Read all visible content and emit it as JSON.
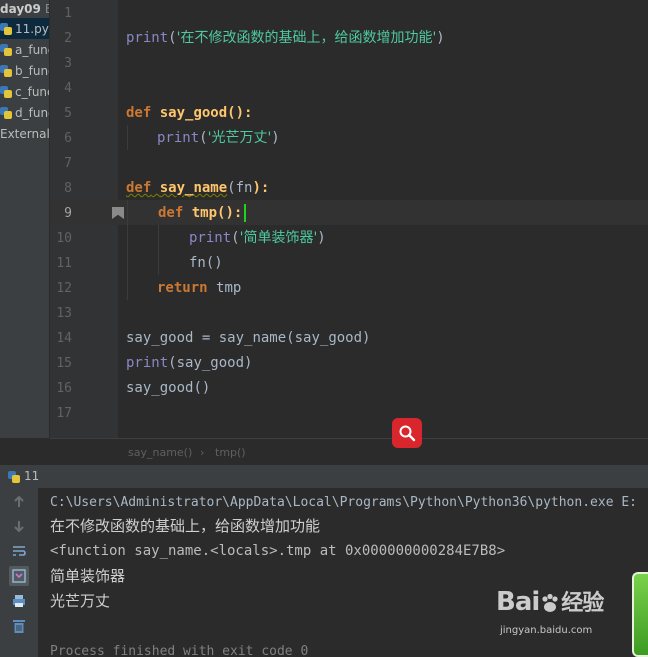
{
  "project": {
    "title": "day09",
    "path": "E:",
    "items": [
      {
        "label": "11.py",
        "icon": "python-file-icon"
      },
      {
        "label": "a_func",
        "icon": "python-file-icon"
      },
      {
        "label": "b_func",
        "icon": "python-file-icon"
      },
      {
        "label": "c_func",
        "icon": "python-file-icon"
      },
      {
        "label": "d_func",
        "icon": "python-file-icon"
      },
      {
        "label": "External L",
        "icon": "library-icon"
      }
    ]
  },
  "editor": {
    "line_numbers": [
      "1",
      "2",
      "3",
      "4",
      "5",
      "6",
      "7",
      "8",
      "9",
      "10",
      "11",
      "12",
      "13",
      "14",
      "15",
      "16",
      "17"
    ],
    "strings": {
      "s1": "'在不修改函数的基础上，给函数增加功能'",
      "s2": "'光芒万丈'",
      "s3": "'简单装饰器'"
    },
    "tokens": {
      "print": "print",
      "def": "def",
      "return": "return",
      "say_good": "say_good",
      "say_name": "say_name",
      "fn": "fn",
      "tmp": "tmp",
      "eq": " = "
    },
    "current_line": 9
  },
  "breadcrumb": {
    "items": [
      "say_name()",
      "tmp()"
    ],
    "separator": "›"
  },
  "run": {
    "tab_label": "11",
    "output": [
      "C:\\Users\\Administrator\\AppData\\Local\\Programs\\Python\\Python36\\python.exe E:",
      "在不修改函数的基础上，给函数增加功能",
      "<function say_name.<locals>.tmp at 0x000000000284E7B8>",
      "简单装饰器",
      "光芒万丈",
      "",
      "Process finished with exit code 0"
    ]
  },
  "watermark": {
    "logo_prefix": "Bai",
    "logo_suffix": "经验",
    "url": "jingyan.baidu.com"
  },
  "colors": {
    "keyword": "#cc7832",
    "function": "#ffc66d",
    "builtin": "#8888c6",
    "string_zh": "#4ec9a0",
    "caret": "#1fd31f",
    "badge": "#d9262c"
  }
}
